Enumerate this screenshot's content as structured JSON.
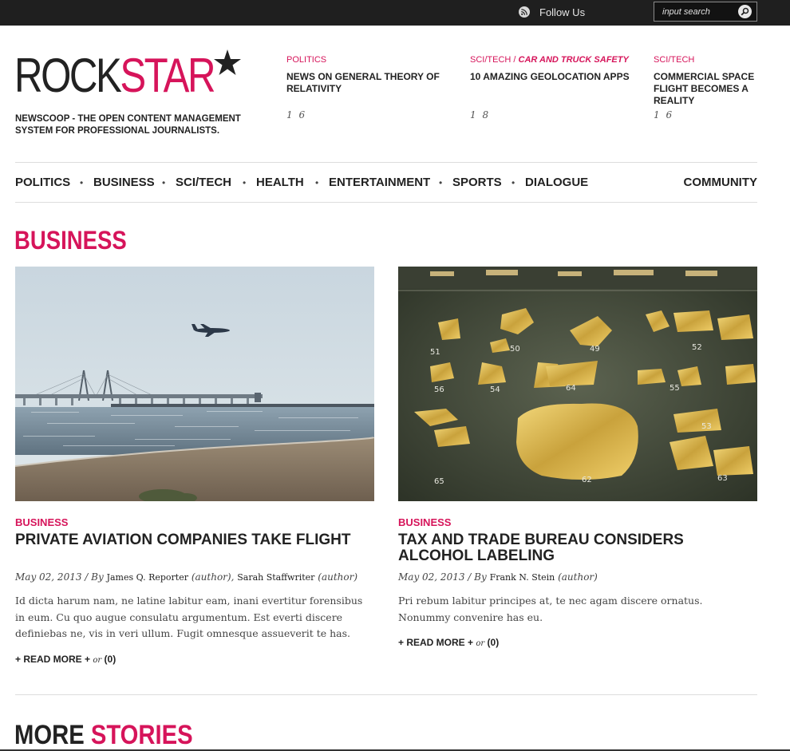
{
  "topbar": {
    "follow_label": "Follow Us",
    "search_placeholder": "input search"
  },
  "logo": {
    "part1": "ROCK",
    "part2": "STAR"
  },
  "tagline": "NEWSCOOP - THE OPEN CONTENT MANAGEMENT SYSTEM FOR PROFESSIONAL JOURNALISTS.",
  "teasers": [
    {
      "category": "POLITICS",
      "subcategory": "",
      "title": "NEWS ON GENERAL THEORY OF RELATIVITY",
      "meta": "1 6"
    },
    {
      "category": "SCI/TECH",
      "subcategory": "CAR AND TRUCK SAFETY",
      "title": "10 AMAZING GEOLOCATION APPS",
      "meta": "1 8"
    },
    {
      "category": "SCI/TECH",
      "subcategory": "",
      "title": "COMMERCIAL SPACE FLIGHT BECOMES A REALITY",
      "meta": "1 6"
    }
  ],
  "nav": {
    "items": [
      "POLITICS",
      "BUSINESS",
      "SCI/TECH",
      "HEALTH",
      "ENTERTAINMENT",
      "SPORTS",
      "DIALOGUE"
    ],
    "community": "COMMUNITY"
  },
  "section_title": "BUSINESS",
  "articles": [
    {
      "category": "BUSINESS",
      "title": "PRIVATE AVIATION COMPANIES TAKE FLIGHT",
      "date": "May 02, 2013 / By",
      "authors": [
        "James Q. Reporter",
        "Sarah Staffwriter"
      ],
      "author_role": "(author)",
      "body": "Id dicta harum nam, ne latine labitur eam, inani evertitur forensibus in eum. Cu quo augue consulatu argumentum. Est everti discere definiebas ne, vis in veri ullum. Fugit omnesque assueverit te has.",
      "read_more": "+ READ MORE +",
      "or": "or",
      "comments": "(0)"
    },
    {
      "category": "BUSINESS",
      "title": "TAX AND TRADE BUREAU CONSIDERS ALCOHOL LABELING",
      "date": "May 02, 2013 / By",
      "authors": [
        "Frank N. Stein"
      ],
      "author_role": "(author)",
      "body": "Pri rebum labitur principes at, te nec agam discere ornatus. Nonummy convenire has eu.",
      "read_more": "+ READ MORE +",
      "or": "or",
      "comments": "(0)"
    }
  ],
  "more_stories": {
    "part1": "MORE",
    "part2": "STORIES"
  },
  "colors": {
    "accent": "#d6145a",
    "text": "#222222",
    "topbar": "#1f1f1f"
  }
}
